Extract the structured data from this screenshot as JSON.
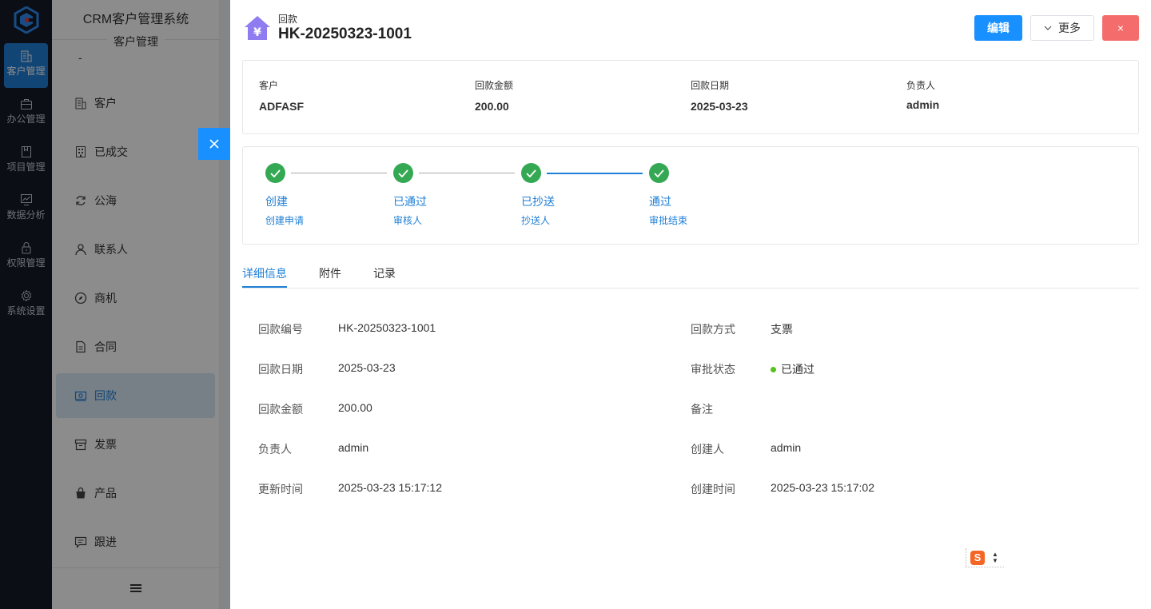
{
  "rail": {
    "items": [
      {
        "label": "客户管理",
        "icon": "building-icon",
        "active": true
      },
      {
        "label": "办公管理",
        "icon": "briefcase-icon",
        "active": false
      },
      {
        "label": "项目管理",
        "icon": "book-icon",
        "active": false
      },
      {
        "label": "数据分析",
        "icon": "chart-icon",
        "active": false
      },
      {
        "label": "权限管理",
        "icon": "lock-icon",
        "active": false
      },
      {
        "label": "系统设置",
        "icon": "gear-icon",
        "active": false
      }
    ]
  },
  "sidebar": {
    "system_title": "CRM客户管理系统",
    "group_title": "客户管理",
    "dash": "-",
    "items": [
      {
        "label": "客户",
        "icon": "building-icon"
      },
      {
        "label": "已成交",
        "icon": "office-icon"
      },
      {
        "label": "公海",
        "icon": "refresh-icon"
      },
      {
        "label": "联系人",
        "icon": "user-icon"
      },
      {
        "label": "商机",
        "icon": "compass-icon"
      },
      {
        "label": "合同",
        "icon": "document-icon"
      },
      {
        "label": "回款",
        "icon": "money-icon",
        "active": true
      },
      {
        "label": "发票",
        "icon": "invoice-icon"
      },
      {
        "label": "产品",
        "icon": "bag-icon"
      },
      {
        "label": "跟进",
        "icon": "message-icon"
      }
    ]
  },
  "drawer": {
    "subtitle": "回款",
    "title": "HK-20250323-1001",
    "edit_label": "编辑",
    "more_label": "更多",
    "close_label": "×"
  },
  "summary": [
    {
      "key": "客户",
      "value": "ADFASF"
    },
    {
      "key": "回款金额",
      "value": "200.00"
    },
    {
      "key": "回款日期",
      "value": "2025-03-23"
    },
    {
      "key": "负责人",
      "value": "admin"
    }
  ],
  "steps": [
    {
      "title": "创建",
      "desc": "创建申请"
    },
    {
      "title": "已通过",
      "desc": "审核人"
    },
    {
      "title": "已抄送",
      "desc": "抄送人"
    },
    {
      "title": "通过",
      "desc": "审批结束"
    }
  ],
  "tabs": [
    {
      "label": "详细信息",
      "active": true
    },
    {
      "label": "附件",
      "active": false
    },
    {
      "label": "记录",
      "active": false
    }
  ],
  "details_left": [
    {
      "key": "回款编号",
      "value": "HK-20250323-1001"
    },
    {
      "key": "回款日期",
      "value": "2025-03-23"
    },
    {
      "key": "回款金额",
      "value": "200.00"
    },
    {
      "key": "负责人",
      "value": "admin"
    },
    {
      "key": "更新时间",
      "value": "2025-03-23 15:17:12"
    }
  ],
  "details_right": [
    {
      "key": "回款方式",
      "value": "支票"
    },
    {
      "key": "审批状态",
      "value": "已通过"
    },
    {
      "key": "备注",
      "value": ""
    },
    {
      "key": "创建人",
      "value": "admin"
    },
    {
      "key": "创建时间",
      "value": "2025-03-23 15:17:02"
    }
  ],
  "ime": {
    "glyph": "S"
  },
  "colors": {
    "primary": "#1890ff",
    "danger": "#f56c6c",
    "success": "#34a853",
    "rail_bg": "#141a27"
  }
}
